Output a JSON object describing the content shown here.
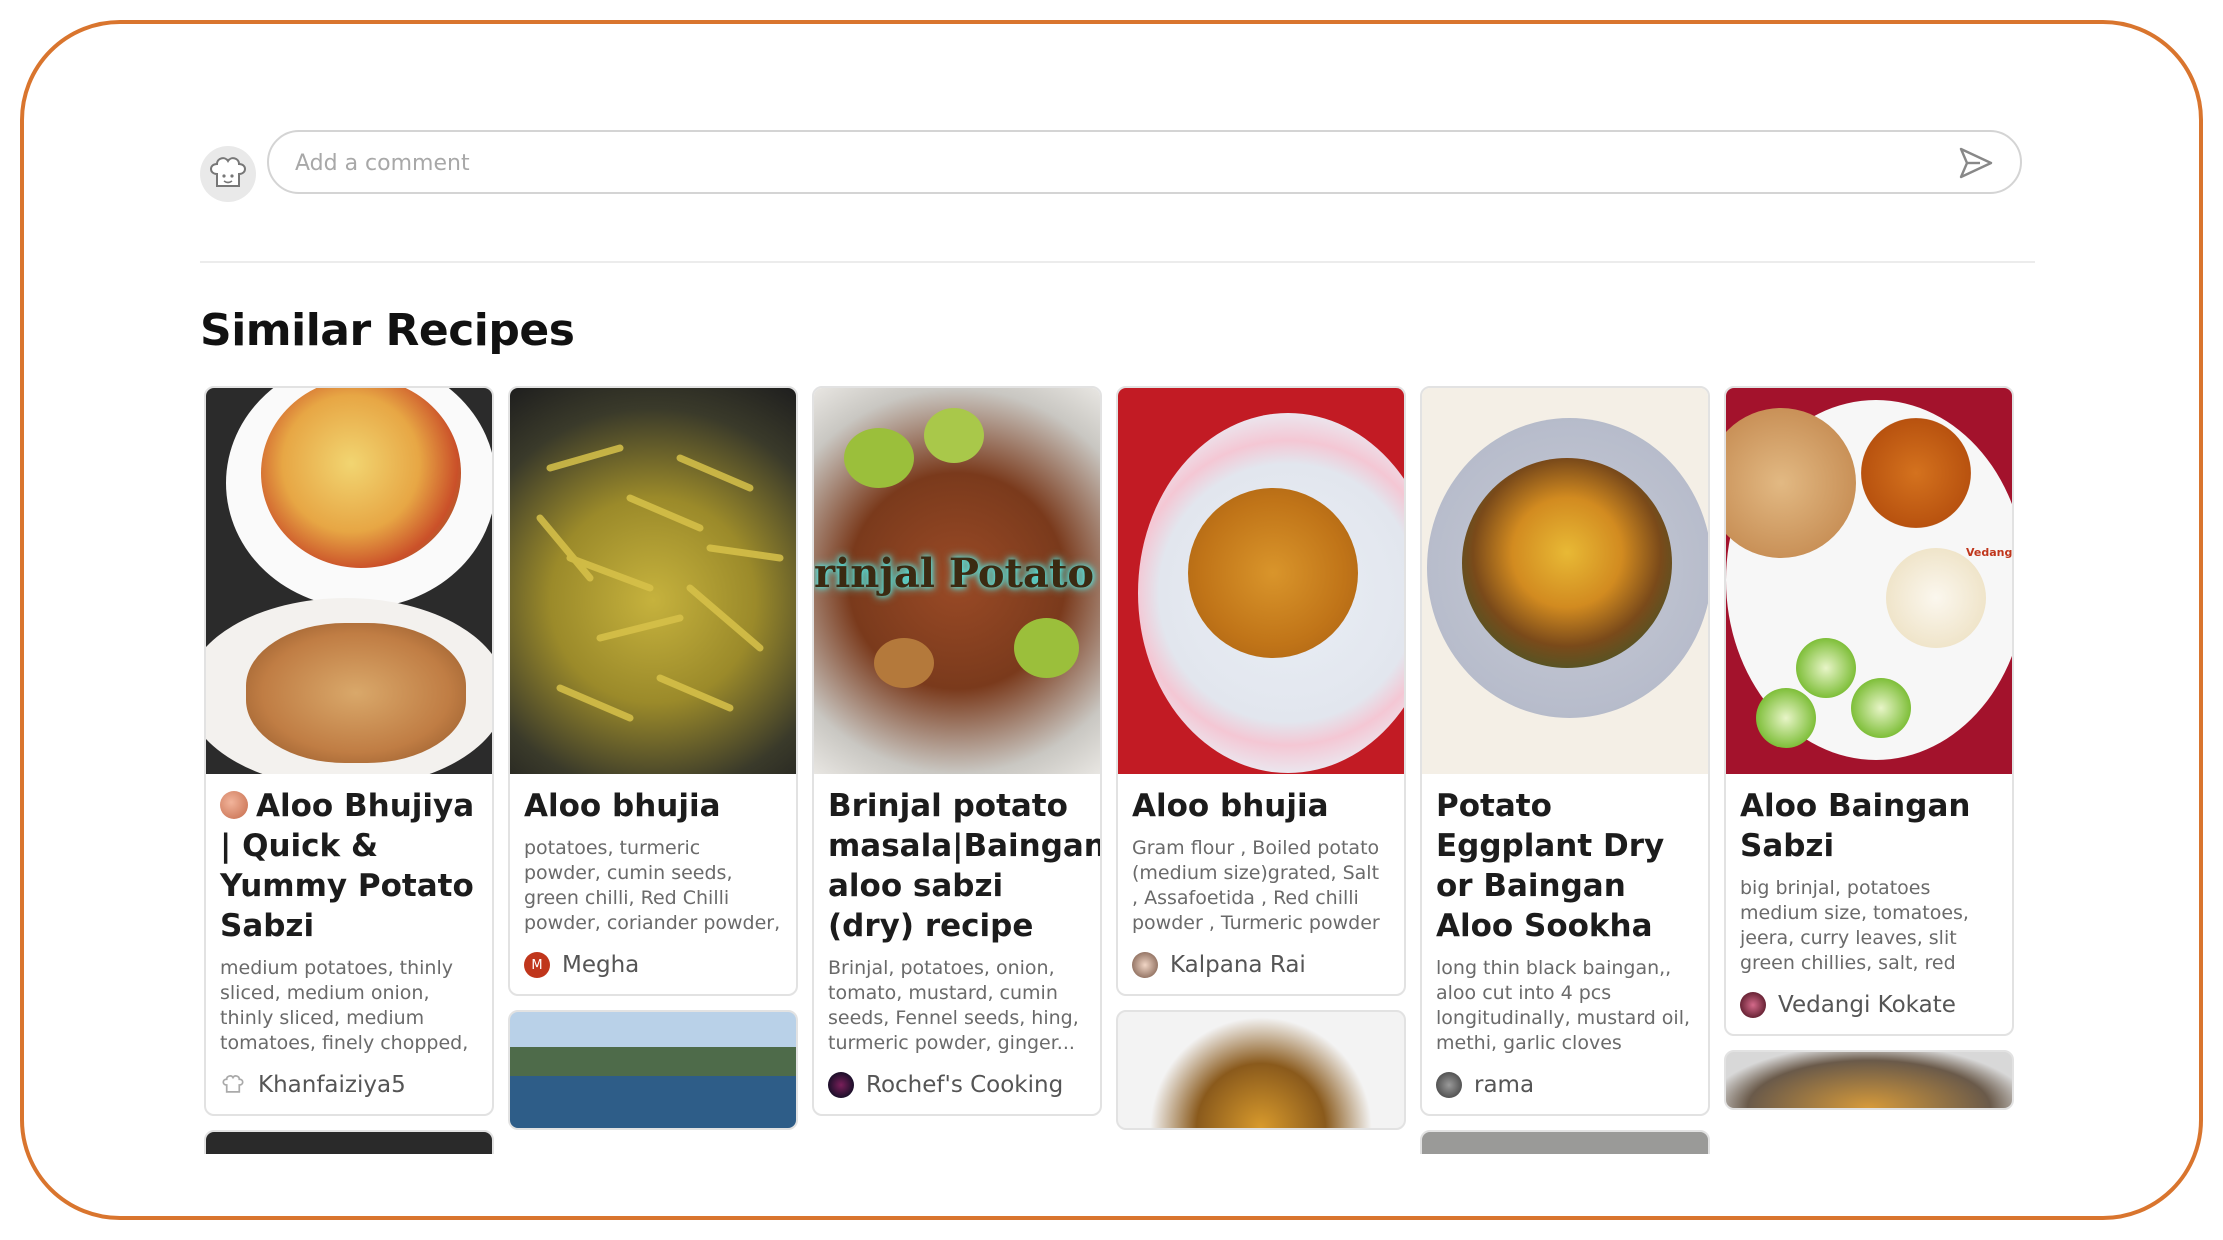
{
  "comment": {
    "placeholder": "Add a comment",
    "send_icon": "send-icon",
    "avatar_icon": "chef-hat-icon"
  },
  "section": {
    "title": "Similar Recipes"
  },
  "cards": [
    {
      "title": "Aloo Bhujiya | Quick & Yummy Potato Sabzi",
      "ingredients": "medium potatoes, thinly sliced, medium onion, thinly sliced, medium tomatoes, finely chopped, green...",
      "author": "Khanfaiziya5",
      "image_text": ""
    },
    {
      "title": "Aloo bhujia",
      "ingredients": "potatoes, turmeric powder, cumin seeds, green chilli, Red Chilli powder, coriander powder, kitchen king or...",
      "author": "Megha",
      "author_initial": "M",
      "image_text": ""
    },
    {
      "title": "Brinjal potato masala|Baingan aloo sabzi (dry) recipe",
      "ingredients": "Brinjal, potatoes, onion, tomato, mustard, cumin seeds, Fennel seeds, hing, turmeric powder, ginger...",
      "author": "Rochef's Cooking",
      "image_text": "rinjal Potato fr"
    },
    {
      "title": "Aloo bhujia",
      "ingredients": "Gram flour , Boiled potato (medium size)grated, Salt , Assafoetida , Red chilli powder , Turmeric powder ,...",
      "author": "Kalpana Rai",
      "image_text": ""
    },
    {
      "title": "Potato Eggplant Dry or Baingan Aloo Sookha",
      "ingredients": "long thin black baingan,, aloo cut into 4 pcs longitudinally, mustard oil, methi, garlic cloves chopped finely, med...",
      "author": "rama",
      "image_text": ""
    },
    {
      "title": "Aloo Baingan Sabzi",
      "ingredients": "big brinjal, potatoes medium size, tomatoes, jeera, curry leaves, slit green chillies, salt, red chilli powder (adjust as...",
      "author": "Vedangi Kokate",
      "image_text": "Vedangi"
    }
  ],
  "colors": {
    "frame_border": "#d9752e",
    "megha_avatar": "#c0361c"
  }
}
